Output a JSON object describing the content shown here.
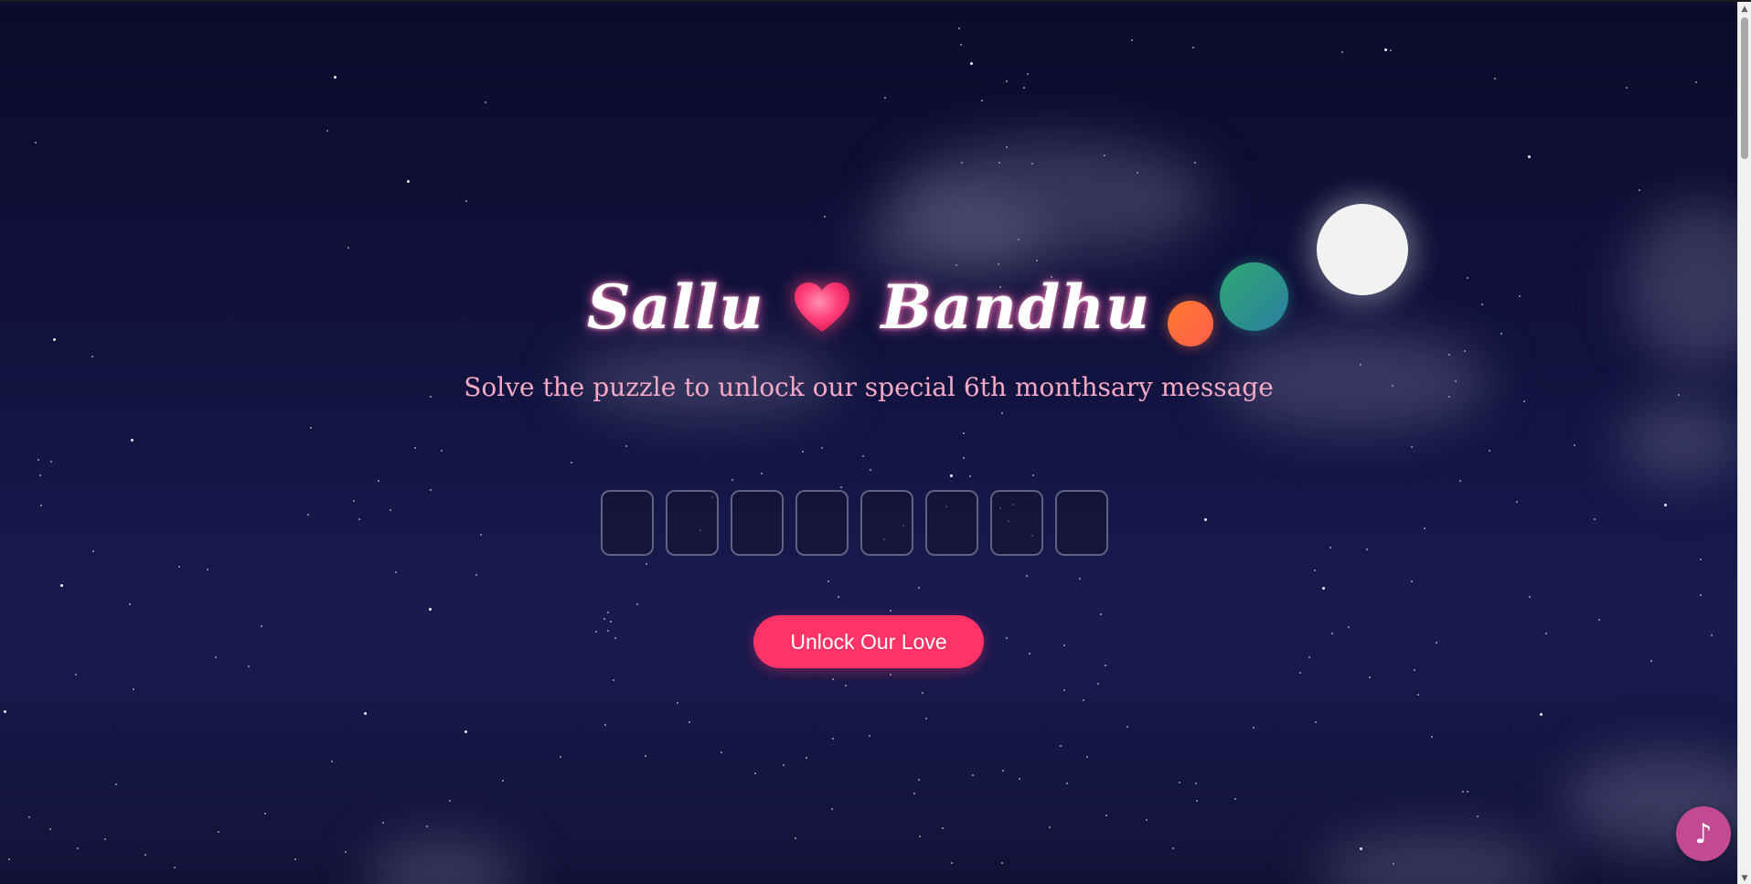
{
  "header": {
    "name_left": "Sallu",
    "name_right": "Bandhu",
    "heart_icon": "heart-icon",
    "subtitle": "Solve the puzzle to unlock our special 6th monthsary message"
  },
  "puzzle": {
    "boxes": [
      "",
      "",
      "",
      "",
      "",
      "",
      "",
      ""
    ]
  },
  "unlock_button": {
    "label": "Unlock Our Love"
  },
  "music_button": {
    "icon": "music-note-icon",
    "label": "♪"
  },
  "colors": {
    "accent": "#ff3366",
    "subtitle": "#f4a9c4",
    "music": "#c14a92",
    "background_top": "#0b0b2c",
    "background_bottom": "#1a1a50"
  },
  "scrollbar": {
    "up_arrow": "▲",
    "down_arrow": "▼"
  }
}
